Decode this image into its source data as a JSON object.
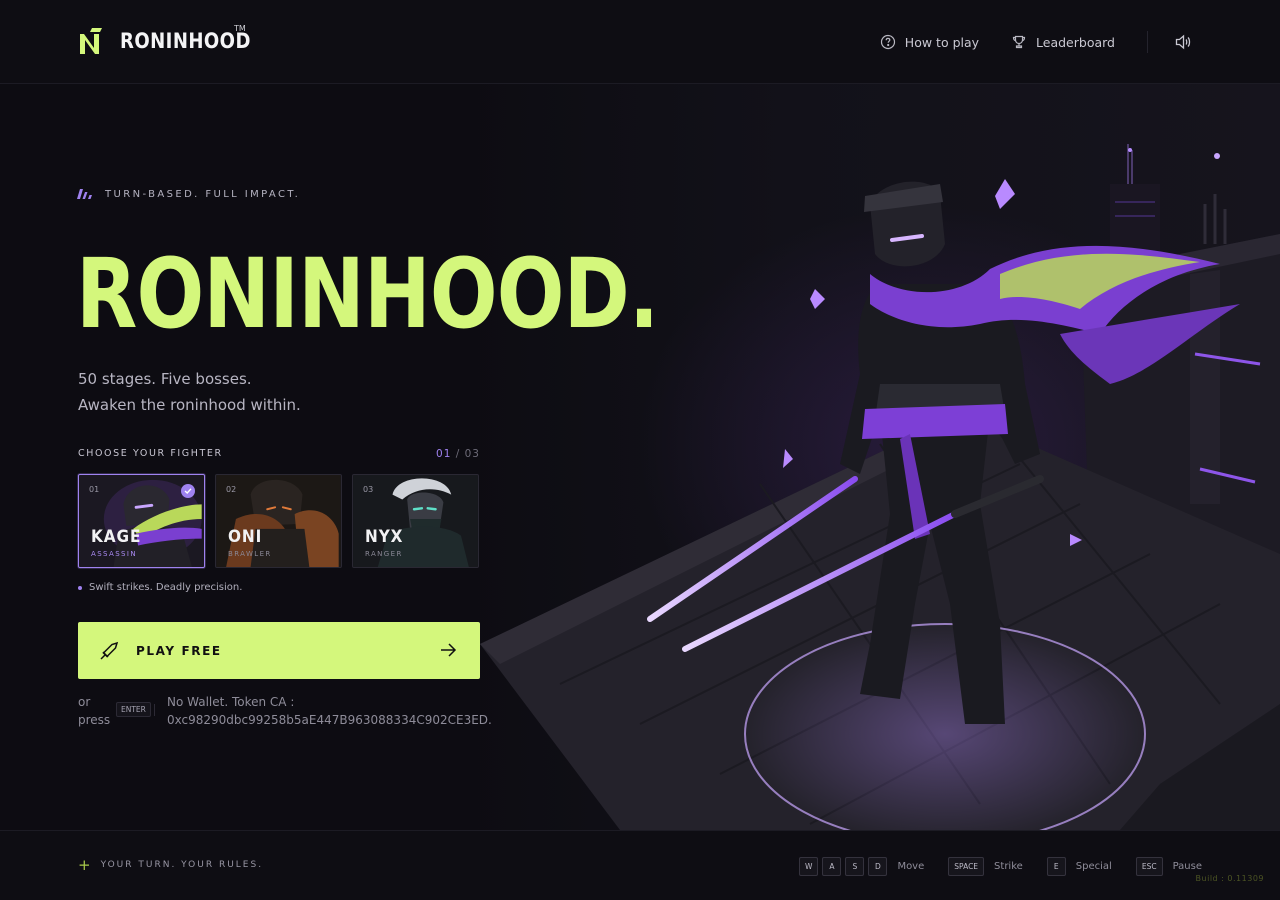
{
  "header": {
    "brand": "RONINHOOD",
    "trademark": "TM",
    "nav": [
      {
        "label": "How to play",
        "icon": "help-circle-icon"
      },
      {
        "label": "Leaderboard",
        "icon": "trophy-icon"
      }
    ],
    "sound_icon": "speaker-icon"
  },
  "hero": {
    "tagline": "TURN-BASED. FULL IMPACT.",
    "title": "RONINHOOD.",
    "subtitle_line1": "50 stages. Five bosses.",
    "subtitle_line2": "Awaken the roninhood within."
  },
  "fighter_select": {
    "label": "CHOOSE YOUR FIGHTER",
    "current": "01",
    "separator": " / ",
    "total": "03",
    "fighters": [
      {
        "num": "01",
        "name": "KAGE",
        "role": "ASSASSIN",
        "selected": true
      },
      {
        "num": "02",
        "name": "ONI",
        "role": "BRAWLER",
        "selected": false
      },
      {
        "num": "03",
        "name": "NYX",
        "role": "RANGER",
        "selected": false
      }
    ],
    "description": "Swift strikes. Deadly precision."
  },
  "play": {
    "label": "PLAY FREE",
    "or_line1": "or",
    "or_line2": "press",
    "key": "ENTER",
    "info_line1": "No Wallet. Token CA :",
    "info_line2": "0xc98290dbc99258b5aE447B963088334C902CE3ED."
  },
  "footer": {
    "slogan": "YOUR TURN. YOUR RULES.",
    "controls": [
      {
        "keys": [
          "W",
          "A",
          "S",
          "D"
        ],
        "label": "Move"
      },
      {
        "keys": [
          "SPACE"
        ],
        "label": "Strike"
      },
      {
        "keys": [
          "E"
        ],
        "label": "Special"
      },
      {
        "keys": [
          "ESC"
        ],
        "label": "Pause"
      }
    ],
    "build": "Build : 0.11309"
  },
  "colors": {
    "accent_lime": "#d4f77c",
    "accent_purple": "#9f82f0",
    "background": "#0d0c12"
  }
}
